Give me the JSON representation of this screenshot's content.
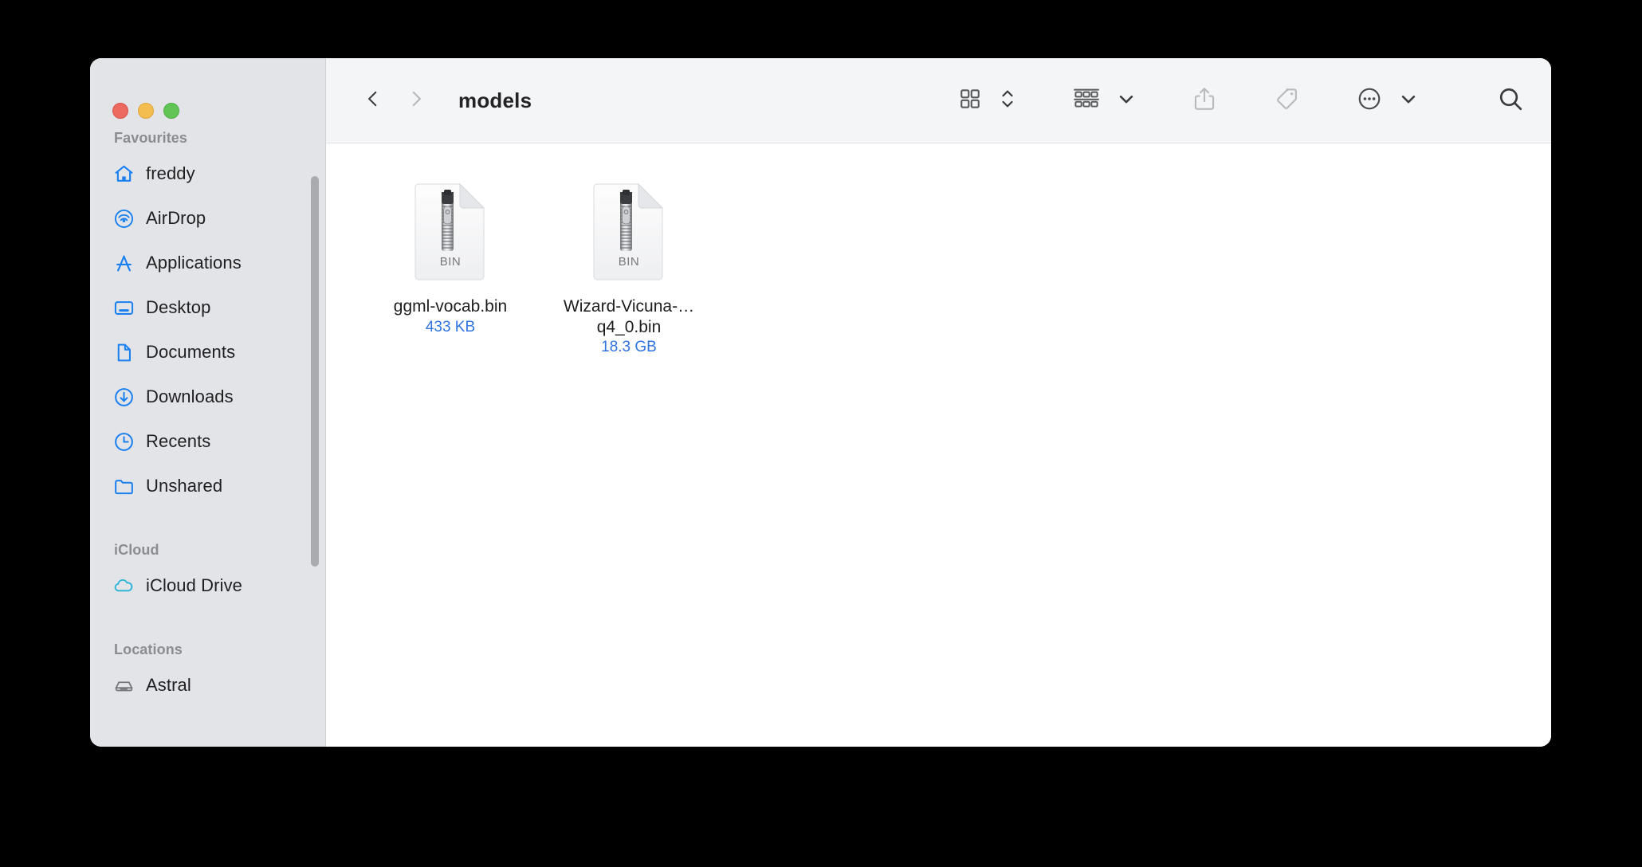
{
  "window": {
    "title": "models",
    "traffic_lights": [
      {
        "name": "close",
        "color": "#ec6a5f"
      },
      {
        "name": "minimize",
        "color": "#f4bd4f"
      },
      {
        "name": "maximize",
        "color": "#61c555"
      }
    ]
  },
  "toolbar": {
    "back_icon": "chevron-left-icon",
    "forward_icon": "chevron-right-icon",
    "view_grid_icon": "grid-view-icon",
    "view_stepper_icon": "chevron-up-down-icon",
    "group_icon": "group-by-icon",
    "group_chevron_icon": "chevron-down-icon",
    "share_icon": "share-icon",
    "tag_icon": "tag-icon",
    "more_icon": "ellipsis-circle-icon",
    "more_chevron_icon": "chevron-down-icon",
    "search_icon": "search-icon"
  },
  "sidebar": {
    "sections": [
      {
        "title": "Favourites",
        "items": [
          {
            "label": "freddy",
            "icon": "house-icon",
            "icon_color": "#1a80f0"
          },
          {
            "label": "AirDrop",
            "icon": "airdrop-icon",
            "icon_color": "#1a80f0"
          },
          {
            "label": "Applications",
            "icon": "applications-icon",
            "icon_color": "#1a80f0"
          },
          {
            "label": "Desktop",
            "icon": "desktop-icon",
            "icon_color": "#1a80f0"
          },
          {
            "label": "Documents",
            "icon": "document-icon",
            "icon_color": "#1a80f0"
          },
          {
            "label": "Downloads",
            "icon": "download-circle-icon",
            "icon_color": "#1a80f0"
          },
          {
            "label": "Recents",
            "icon": "clock-icon",
            "icon_color": "#1a80f0"
          },
          {
            "label": "Unshared",
            "icon": "folder-icon",
            "icon_color": "#1a80f0"
          }
        ]
      },
      {
        "title": "iCloud",
        "items": [
          {
            "label": "iCloud Drive",
            "icon": "cloud-icon",
            "icon_color": "#32b6d8"
          }
        ]
      },
      {
        "title": "Locations",
        "items": [
          {
            "label": "Astral",
            "icon": "external-drive-icon",
            "icon_color": "#76777b"
          }
        ]
      }
    ]
  },
  "content": {
    "files": [
      {
        "name": "ggml-vocab.bin",
        "size": "433 KB",
        "kind_label": "BIN",
        "icon": "bin-file-icon"
      },
      {
        "name": "Wizard-Vicuna-…q4_0.bin",
        "size": "18.3 GB",
        "kind_label": "BIN",
        "icon": "bin-file-icon"
      }
    ]
  },
  "colors": {
    "accent": "#1a80f0",
    "size_text": "#2f74e0",
    "sidebar_bg": "#e3e4e8",
    "toolbar_bg": "#f4f5f7"
  }
}
